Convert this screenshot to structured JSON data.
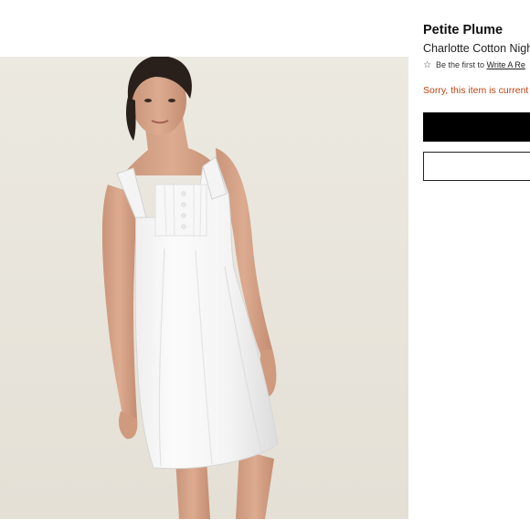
{
  "product": {
    "brand": "Petite Plume",
    "name": "Charlotte Cotton Nigh",
    "review_prefix": "Be the first to",
    "review_link": "Write A Re",
    "stock_message": "Sorry, this item is current",
    "image_alt": "Model wearing white sleeveless cotton nightgown"
  },
  "icons": {
    "rating": "star-outline-icon"
  },
  "colors": {
    "brand_text": "#111111",
    "stock_message": "#c1440e",
    "primary_button": "#000000",
    "image_background": "#e8e4db"
  }
}
